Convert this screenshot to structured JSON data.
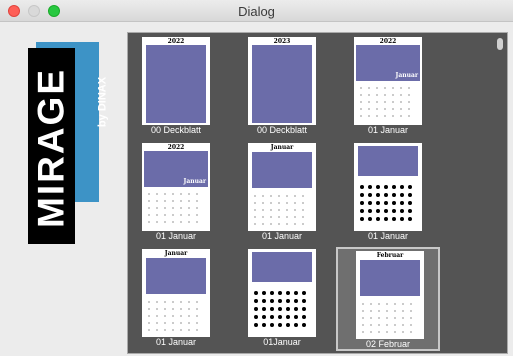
{
  "window": {
    "title": "Dialog"
  },
  "logo": {
    "brand": "MIRAGE",
    "sub": "by DINAX"
  },
  "thumbnails": [
    {
      "caption": "00 Deckblatt",
      "header": "2022",
      "style": "cover"
    },
    {
      "caption": "00 Deckblatt",
      "header": "2023",
      "style": "cover"
    },
    {
      "caption": "01 Januar",
      "header": "Januar",
      "style": "month-overlay"
    },
    {
      "caption": "01 Januar",
      "header": "Januar",
      "style": "month-overlay"
    },
    {
      "caption": "01 Januar",
      "header": "Januar",
      "style": "month-top"
    },
    {
      "caption": "01 Januar",
      "header": "",
      "style": "dots"
    },
    {
      "caption": "01 Januar",
      "header": "Januar",
      "style": "month-top"
    },
    {
      "caption": "01Januar",
      "header": "",
      "style": "dots"
    },
    {
      "caption": "02 Februar",
      "header": "Februar",
      "style": "month-top",
      "selected": true
    }
  ],
  "colors": {
    "photo": "#6b6ca9",
    "panel": "#545454",
    "logo_blue": "#3d93c6"
  }
}
